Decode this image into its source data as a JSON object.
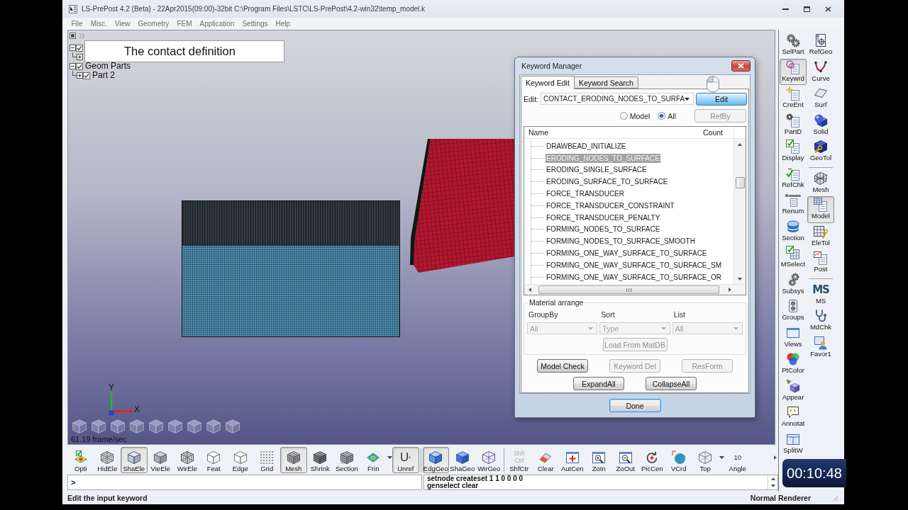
{
  "window": {
    "title": "LS-PrePost 4.2 (Beta) - 22Apr2015(09:00)-32bit C:\\Program Files\\LSTC\\LS-PrePost\\4.2-win32\\temp_model.k"
  },
  "menu": [
    "File",
    "Misc.",
    "View",
    "Geometry",
    "FEM",
    "Application",
    "Settings",
    "Help"
  ],
  "caption": "The contact definition",
  "model_tree": [
    {
      "checked": true,
      "expanded": true,
      "children": [
        {
          "expanded": false
        }
      ]
    },
    {
      "label": "Geom Parts",
      "checked": true,
      "expanded": true,
      "children": [
        {
          "label": "Part 2",
          "checked": true,
          "expanded": false
        }
      ]
    }
  ],
  "viewport": {
    "axes": [
      "Y",
      "X"
    ],
    "frame_rate": "61.19 frame/sec"
  },
  "keyword_manager": {
    "title": "Keyword Manager",
    "tabs": [
      {
        "label": "Keyword Edit",
        "selected": true
      },
      {
        "label": "Keyword Search",
        "selected": false
      }
    ],
    "edit": {
      "label": "Edit:",
      "value": "CONTACT_ERODING_NODES_TO_SURFA",
      "button": "Edit"
    },
    "scope": [
      {
        "label": "Model",
        "selected": false
      },
      {
        "label": "All",
        "selected": true
      }
    ],
    "refby": {
      "label": "RefBy",
      "disabled": true
    },
    "list": {
      "columns": [
        "Name",
        "Count"
      ],
      "items": [
        {
          "name": "DRAWBEAD_INITIALIZE",
          "selected": false
        },
        {
          "name": "ERODING_NODES_TO_SURFACE",
          "selected": true
        },
        {
          "name": "ERODING_SINGLE_SURFACE",
          "selected": false
        },
        {
          "name": "ERODING_SURFACE_TO_SURFACE",
          "selected": false
        },
        {
          "name": "FORCE_TRANSDUCER",
          "selected": false
        },
        {
          "name": "FORCE_TRANSDUCER_CONSTRAINT",
          "selected": false
        },
        {
          "name": "FORCE_TRANSDUCER_PENALTY",
          "selected": false
        },
        {
          "name": "FORMING_NODES_TO_SURFACE",
          "selected": false
        },
        {
          "name": "FORMING_NODES_TO_SURFACE_SMOOTH",
          "selected": false
        },
        {
          "name": "FORMING_ONE_WAY_SURFACE_TO_SURFACE",
          "selected": false
        },
        {
          "name": "FORMING_ONE_WAY_SURFACE_TO_SURFACE_SM",
          "selected": false
        },
        {
          "name": "FORMING_ONE_WAY_SURFACE_TO_SURFACE_OR",
          "selected": false
        }
      ]
    },
    "material_arrange": {
      "title": "Material arrange",
      "fields": [
        {
          "label": "GroupBy",
          "value": "All",
          "disabled": true
        },
        {
          "label": "Sort",
          "value": "Type",
          "disabled": true
        },
        {
          "label": "List",
          "value": "All",
          "disabled": true
        }
      ],
      "load": {
        "label": "Load From MatDB",
        "disabled": true
      }
    },
    "actions": [
      {
        "label": "Model Check",
        "disabled": false
      },
      {
        "label": "Keyword Del",
        "disabled": true
      },
      {
        "label": "ResForm",
        "disabled": true
      }
    ],
    "tree_buttons": [
      "ExpandAll",
      "CollapseAll"
    ],
    "done": "Done"
  },
  "right_toolbar": [
    [
      {
        "kind": "tool",
        "label": "SelPart",
        "selected": false
      },
      {
        "kind": "tool",
        "label": "Keywrd",
        "selected": true
      },
      {
        "kind": "tool",
        "label": "CreEnt",
        "selected": false
      },
      {
        "kind": "tool",
        "label": "PartD",
        "selected": false
      },
      {
        "kind": "tool",
        "label": "Display",
        "selected": false
      },
      {
        "kind": "tool",
        "label": "RefChk",
        "selected": false
      },
      {
        "kind": "tool",
        "label": "Renum",
        "icon_text": "Renum",
        "selected": false
      },
      {
        "kind": "tool",
        "label": "Section",
        "selected": false
      },
      {
        "kind": "tool",
        "label": "MSelect",
        "selected": false
      },
      {
        "kind": "tool",
        "label": "Subsys",
        "selected": false
      },
      {
        "kind": "tool",
        "label": "Groups",
        "selected": false
      },
      {
        "kind": "tool",
        "label": "Views",
        "selected": false
      },
      {
        "kind": "tool",
        "label": "PtColor",
        "selected": false
      },
      {
        "kind": "tool",
        "label": "Appear",
        "selected": false
      },
      {
        "kind": "tool",
        "label": "Annotat",
        "selected": false
      },
      {
        "kind": "tool",
        "label": "SplitW",
        "selected": false
      }
    ],
    [
      {
        "kind": "tool",
        "label": "RefGeo",
        "selected": false
      },
      {
        "kind": "tool",
        "label": "Curve",
        "selected": false
      },
      {
        "kind": "tool",
        "label": "Surf",
        "selected": false
      },
      {
        "kind": "tool",
        "label": "Solid",
        "selected": false
      },
      {
        "kind": "tool",
        "label": "GeoTol",
        "selected": false
      },
      {
        "kind": "separator"
      },
      {
        "kind": "tool",
        "label": "Mesh",
        "selected": false
      },
      {
        "kind": "tool",
        "label": "Model",
        "selected": true
      },
      {
        "kind": "tool",
        "label": "EleTol",
        "selected": false
      },
      {
        "kind": "tool",
        "label": "Post",
        "selected": false
      },
      {
        "kind": "separator"
      },
      {
        "kind": "logo",
        "glyph": "MS",
        "label": "MS",
        "selected": false
      },
      {
        "kind": "tool",
        "label": "MdChk",
        "selected": false
      },
      {
        "kind": "tool",
        "label": "Favor1",
        "selected": false
      }
    ]
  ],
  "bottom_toolbar": [
    {
      "kind": "tool",
      "label": "Opti",
      "selected": false,
      "has_menu": false
    },
    {
      "kind": "tool",
      "label": "HidEle",
      "selected": false,
      "has_menu": false
    },
    {
      "kind": "tool",
      "label": "ShaEle",
      "selected": true,
      "has_menu": false
    },
    {
      "kind": "tool",
      "label": "VieEle",
      "selected": false,
      "has_menu": false
    },
    {
      "kind": "tool",
      "label": "WirEle",
      "selected": false,
      "has_menu": false
    },
    {
      "kind": "tool",
      "label": "Feat",
      "selected": false,
      "has_menu": false
    },
    {
      "kind": "tool",
      "label": "Edge",
      "selected": false,
      "has_menu": false
    },
    {
      "kind": "tool",
      "label": "Grid",
      "selected": false,
      "has_menu": false
    },
    {
      "kind": "tool",
      "label": "Mesh",
      "selected": true,
      "has_menu": false
    },
    {
      "kind": "tool",
      "label": "Shrink",
      "selected": false,
      "has_menu": false
    },
    {
      "kind": "tool",
      "label": "Section",
      "selected": false,
      "has_menu": false
    },
    {
      "kind": "tool",
      "label": "Frin",
      "selected": false,
      "has_menu": true
    },
    {
      "kind": "letter",
      "glyph": "U",
      "label": "Unref",
      "selected": true,
      "has_menu": false
    },
    {
      "kind": "separator"
    },
    {
      "kind": "tool",
      "label": "EdgGeo",
      "selected": true,
      "has_menu": false
    },
    {
      "kind": "tool",
      "label": "ShaGeo",
      "selected": false,
      "has_menu": false
    },
    {
      "kind": "tool",
      "label": "WirGeo",
      "selected": false,
      "has_menu": false
    },
    {
      "kind": "separator"
    },
    {
      "kind": "keys",
      "keys": [
        "Shft",
        "Ctrl"
      ],
      "label": "ShfCtr",
      "selected": false,
      "has_menu": false
    },
    {
      "kind": "tool",
      "label": "Clear",
      "selected": false,
      "has_menu": false
    },
    {
      "kind": "tool",
      "label": "AutCen",
      "selected": false,
      "has_menu": false
    },
    {
      "kind": "tool",
      "label": "ZoIn",
      "selected": false,
      "has_menu": false
    },
    {
      "kind": "tool",
      "label": "ZoOut",
      "selected": false,
      "has_menu": false
    },
    {
      "kind": "tool",
      "label": "PicCen",
      "selected": false,
      "has_menu": false
    },
    {
      "kind": "tool",
      "label": "VCrd",
      "selected": false,
      "has_menu": false
    },
    {
      "kind": "tool",
      "label": "Top",
      "selected": false,
      "has_menu": true
    },
    {
      "kind": "value",
      "value": "10",
      "label": "Angle",
      "selected": false,
      "has_menu": false
    }
  ],
  "command": {
    "prompt": ">",
    "history": [
      "setnode createset 1 1 0 0 0 0",
      "genselect clear"
    ]
  },
  "status_bar": {
    "message": "Edit the input keyword",
    "renderer": "Normal Renderer"
  },
  "timer": "00:10:48"
}
